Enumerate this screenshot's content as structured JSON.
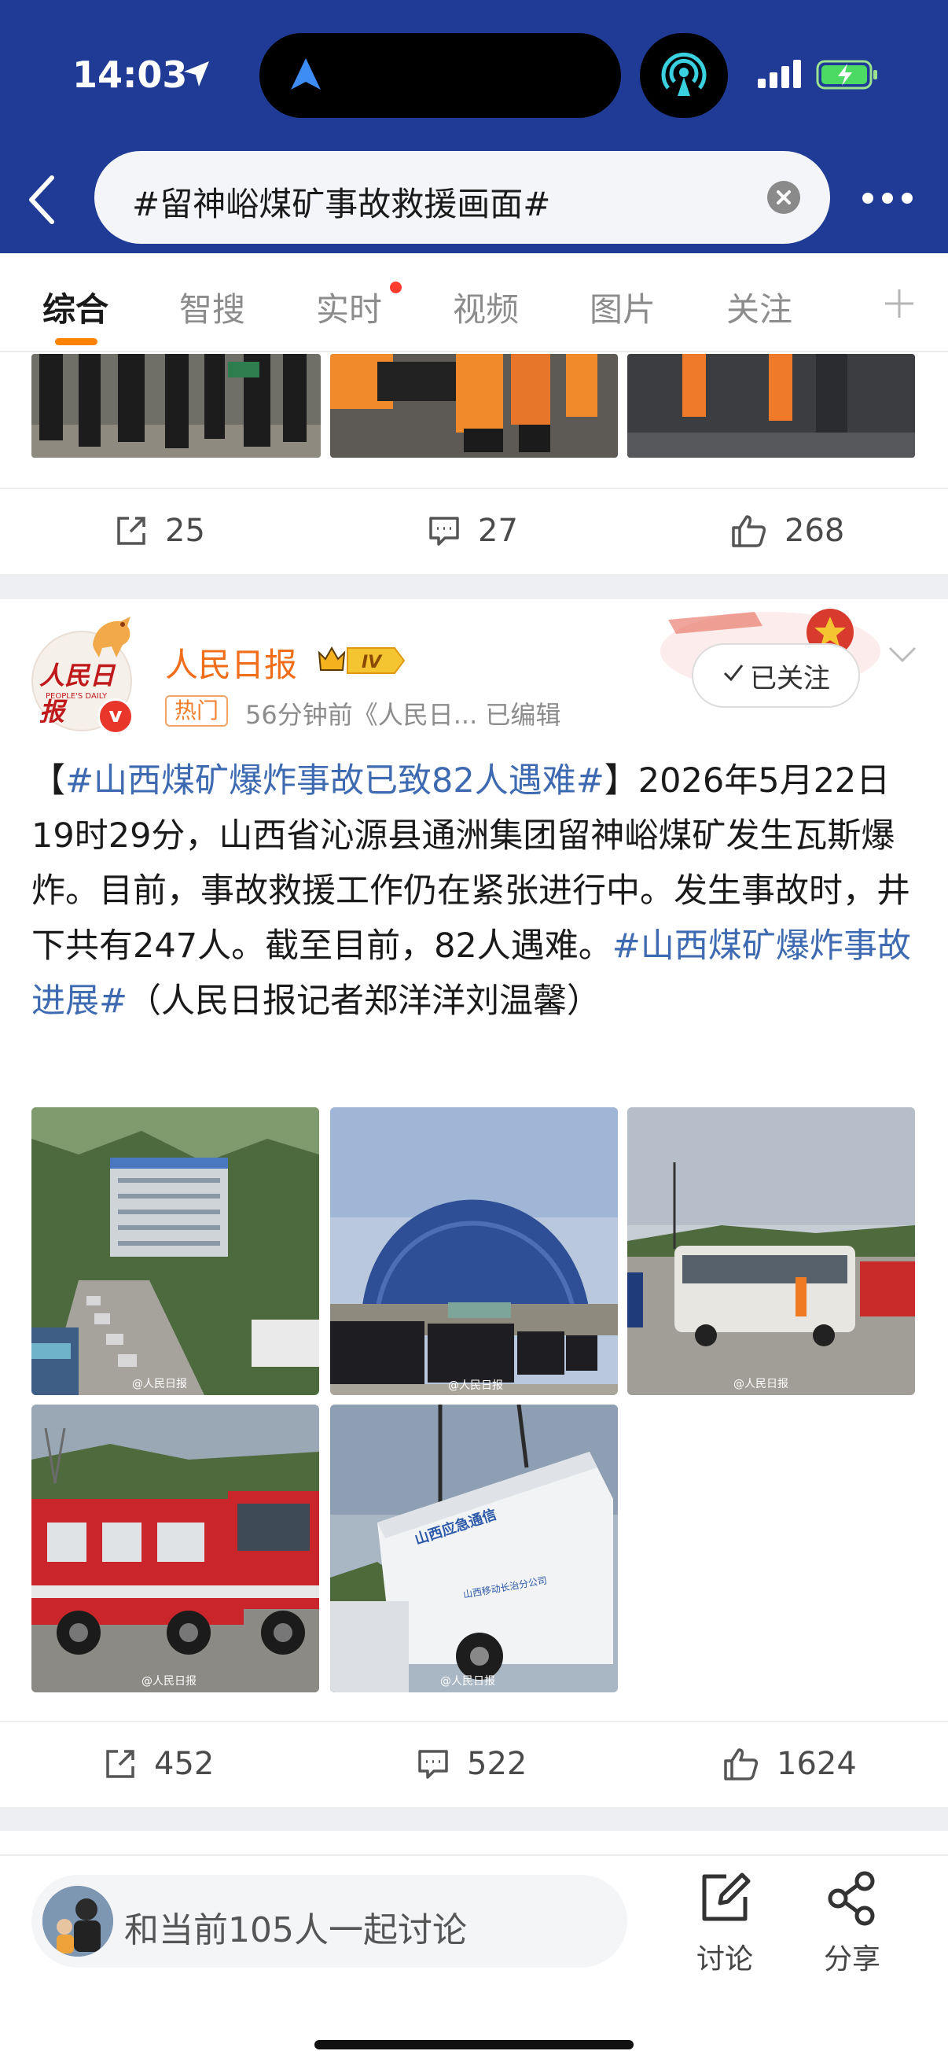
{
  "status_bar": {
    "time": "14:03"
  },
  "search": {
    "query": "#留神峪煤矿事故救援画面#"
  },
  "tabs": [
    {
      "label": "综合",
      "active": true
    },
    {
      "label": "智搜"
    },
    {
      "label": "实时",
      "has_dot": true
    },
    {
      "label": "视频"
    },
    {
      "label": "图片"
    },
    {
      "label": "关注"
    }
  ],
  "prev_post": {
    "reposts": "25",
    "comments": "27",
    "likes": "268"
  },
  "post": {
    "author": "人民日报",
    "avatar_text": "人民日报",
    "avatar_sub": "PEOPLE'S DAILY",
    "vip_level": "IV",
    "hot_tag": "热门",
    "meta": "56分钟前《人民日... 已编辑",
    "follow_label": "已关注",
    "text": {
      "bracket_open": "【",
      "hashtag1": "#山西煤矿爆炸事故已致82人遇难#",
      "bracket_close": "】",
      "body": "2026年5月22日19时29分，山西省沁源县通洲集团留神峪煤矿发生瓦斯爆炸。目前，事故救援工作仍在紧张进行中。发生事故时，井下共有247人。截至目前，82人遇难。",
      "hashtag2": "#山西煤矿爆炸事故进展#",
      "credit": "（人民日报记者郑洋洋刘温馨）"
    },
    "image_watermark": "@人民日报",
    "truck_text_1": "山西应急通信",
    "truck_text_2": "山西移动长治分公司",
    "reposts": "452",
    "comments": "522",
    "likes": "1624"
  },
  "bottom_bar": {
    "discuss_placeholder": "和当前105人一起讨论",
    "discuss_label": "讨论",
    "share_label": "分享"
  },
  "colors": {
    "header_bg": "#1f3b96",
    "accent_orange": "#ff8200",
    "hashtag_blue": "#3d6ab0",
    "author_orange": "#f06d1a"
  }
}
